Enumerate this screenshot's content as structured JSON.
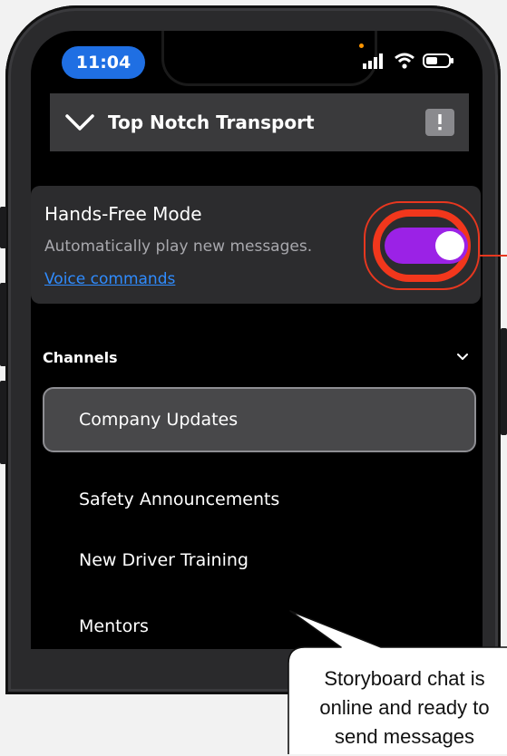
{
  "status_bar": {
    "time": "11:04"
  },
  "header": {
    "workspace_name": "Top Notch Transport"
  },
  "hands_free": {
    "title": "Hands-Free Mode",
    "description": "Automatically play new messages.",
    "link": "Voice commands",
    "enabled": true
  },
  "channels": {
    "label": "Channels",
    "items": [
      {
        "label": "Company Updates",
        "active": true
      },
      {
        "label": "Safety Announcements",
        "active": false
      },
      {
        "label": "New Driver Training",
        "active": false
      },
      {
        "label": "Mentors",
        "active": false
      }
    ]
  },
  "callout": {
    "lines": [
      "Storyboard chat is",
      "online and ready to",
      "send messages"
    ]
  },
  "colors": {
    "accent_toggle": "#9b22e6",
    "highlight_ring": "#f2371c",
    "time_pill": "#1f6fe3",
    "link": "#2f8cff"
  }
}
